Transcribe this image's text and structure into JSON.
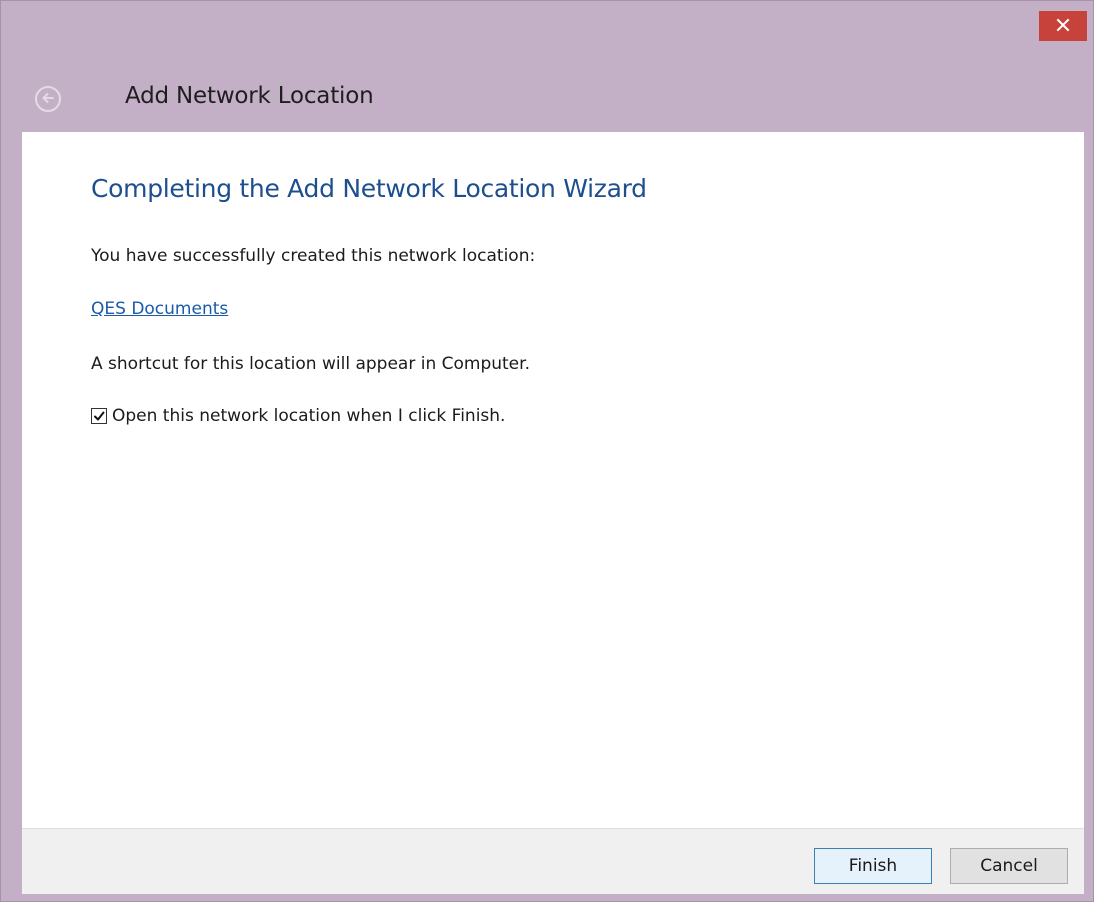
{
  "window": {
    "title": "Add Network Location"
  },
  "wizard": {
    "heading": "Completing the Add Network Location Wizard",
    "success_text": "You have successfully created this network location:",
    "location_name": "QES Documents",
    "shortcut_text": "A shortcut for this location will appear in Computer.",
    "open_checkbox": {
      "label": "Open this network location when I click Finish.",
      "checked": true
    }
  },
  "footer": {
    "finish_label": "Finish",
    "cancel_label": "Cancel"
  },
  "icons": {
    "close": "close-icon",
    "back": "back-arrow-icon",
    "check": "checkmark-icon"
  },
  "colors": {
    "titlebar": "#c3b0c6",
    "close_button": "#c7423a",
    "heading": "#1d4f8e",
    "link": "#1a5aa8",
    "footer": "#f0f0f0"
  }
}
